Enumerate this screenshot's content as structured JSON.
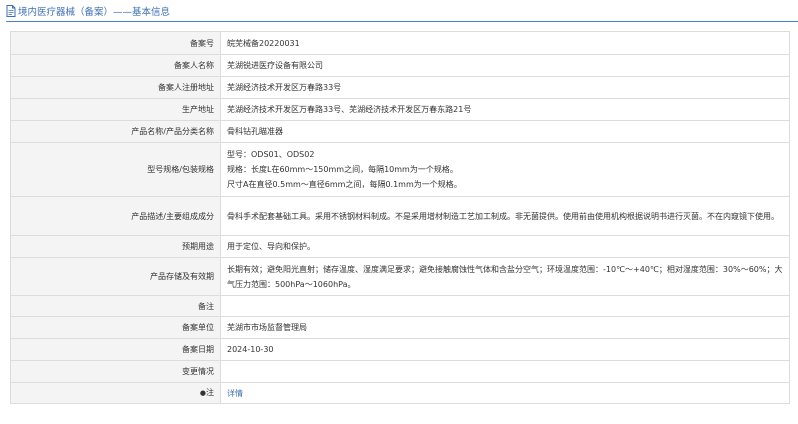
{
  "header": {
    "title": "境内医疗器械（备案）——基本信息"
  },
  "rows": [
    {
      "label": "备案号",
      "value": "皖芜械备20220031"
    },
    {
      "label": "备案人名称",
      "value": "芜湖锐进医疗设备有限公司"
    },
    {
      "label": "备案人注册地址",
      "value": "芜湖经济技术开发区万春路33号"
    },
    {
      "label": "生产地址",
      "value": "芜湖经济技术开发区万春路33号、芜湖经济技术开发区万春东路21号"
    },
    {
      "label": "产品名称/产品分类名称",
      "value": "骨科钻孔瞄准器"
    },
    {
      "label": "型号规格/包装规格",
      "lines": [
        "型号：ODS01、ODS02",
        "规格：长度L在60mm～150mm之间，每隔10mm为一个规格。",
        "尺寸A在直径0.5mm～直径6mm之间，每隔0.1mm为一个规格。"
      ]
    },
    {
      "label": "产品描述/主要组成成分",
      "value": "骨科手术配套基础工具。采用不锈钢材料制成。不是采用增材制造工艺加工制成。非无菌提供。使用前由使用机构根据说明书进行灭菌。不在内窥镜下使用。"
    },
    {
      "label": "预期用途",
      "value": "用于定位、导向和保护。"
    },
    {
      "label": "产品存储及有效期",
      "value": "长期有效；避免阳光直射；储存温度、湿度满足要求；避免接触腐蚀性气体和含盐分空气；环境温度范围：-10℃～+40℃；相对湿度范围：30%～60%；大气压力范围：500hPa～1060hPa。"
    },
    {
      "label": "备注",
      "value": ""
    },
    {
      "label": "备案单位",
      "value": "芜湖市市场监督管理局"
    },
    {
      "label": "备案日期",
      "value": "2024-10-30"
    },
    {
      "label": "变更情况",
      "value": ""
    },
    {
      "label": "注",
      "value": "详情"
    }
  ]
}
